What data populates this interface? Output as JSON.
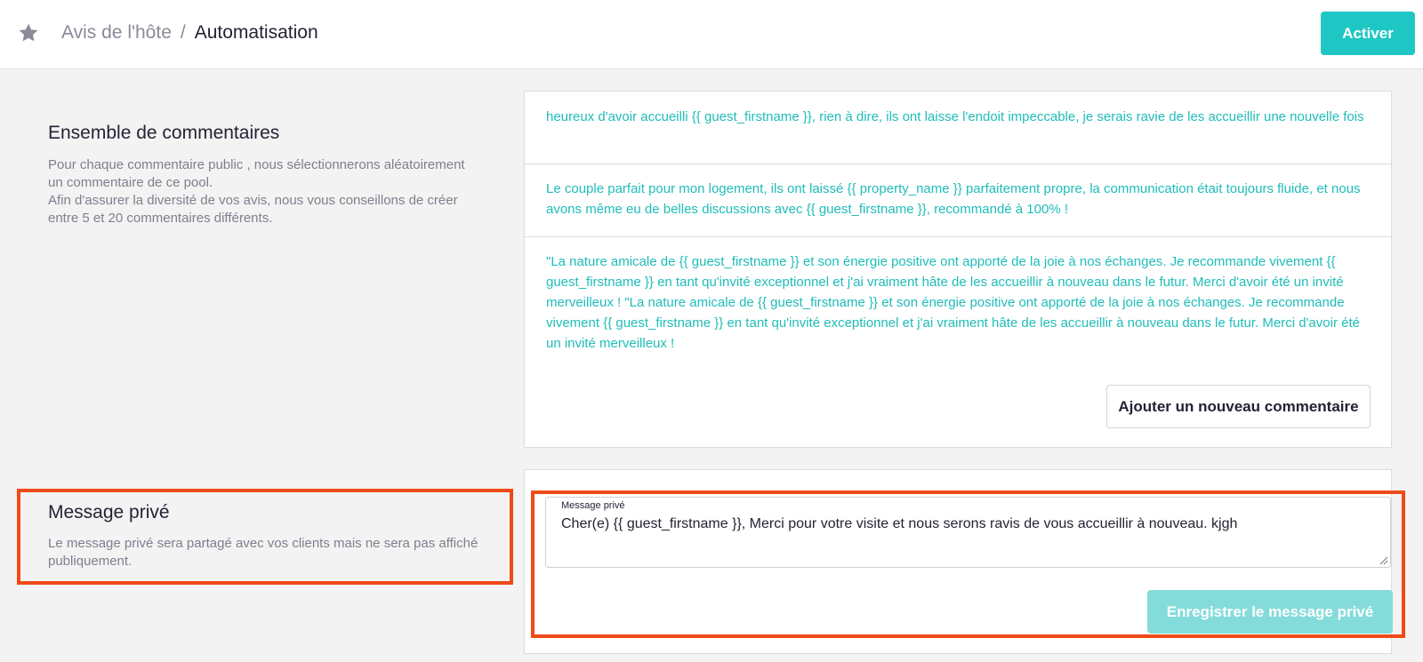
{
  "header": {
    "breadcrumb_parent": "Avis de l'hôte",
    "breadcrumb_separator": "/",
    "breadcrumb_current": "Automatisation",
    "activate_label": "Activer",
    "star_icon": "star-icon"
  },
  "comments_section": {
    "title": "Ensemble de commentaires",
    "description_line1": "Pour chaque commentaire public , nous sélectionnerons aléatoirement un commentaire de ce pool.",
    "description_line2": "Afin d'assurer la diversité de vos avis, nous vous conseillons de créer entre 5 et 20 commentaires différents.",
    "comments": [
      "heureux d'avoir accueilli {{ guest_firstname }}, rien à dire, ils ont laisse l'endoit impeccable, je serais ravie de les accueillir une nouvelle fois",
      "Le couple parfait pour mon logement, ils ont laissé {{ property_name }} parfaitement propre, la communication était toujours fluide, et nous avons même eu de belles discussions avec {{ guest_firstname }}, recommandé à 100% !",
      "\"La nature amicale de {{ guest_firstname }} et son énergie positive ont apporté de la joie à nos échanges. Je recommande vivement {{ guest_firstname }} en tant qu'invité exceptionnel et j'ai vraiment hâte de les accueillir à nouveau dans le futur. Merci d'avoir été un invité merveilleux ! \"La nature amicale de {{ guest_firstname }} et son énergie positive ont apporté de la joie à nos échanges. Je recommande vivement {{ guest_firstname }} en tant qu'invité exceptionnel et j'ai vraiment hâte de les accueillir à nouveau dans le futur. Merci d'avoir été un invité merveilleux !"
    ],
    "add_comment_label": "Ajouter un nouveau commentaire"
  },
  "private_section": {
    "title": "Message privé",
    "description": "Le message privé sera partagé avec vos clients mais ne sera pas affiché publiquement.",
    "field_label": "Message privé",
    "field_value": "Cher(e) {{ guest_firstname }}, Merci pour votre visite et nous serons ravis de vous accueillir à nouveau. kjgh",
    "save_label": "Enregistrer le message privé"
  },
  "colors": {
    "accent": "#1fc7c4",
    "accent_disabled": "#84dcda",
    "comment_text": "#1fbdb9",
    "highlight": "#f04a18"
  }
}
